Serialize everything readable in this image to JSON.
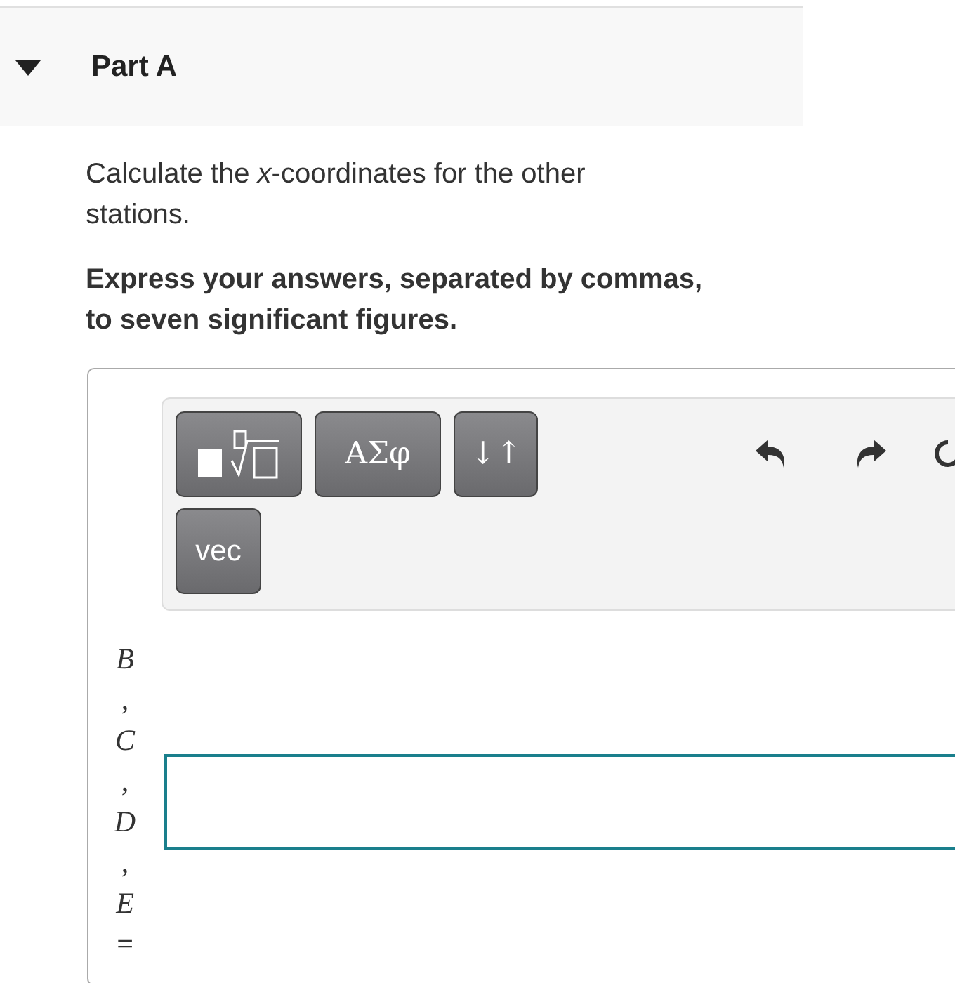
{
  "part": {
    "title": "Part A",
    "expanded": true
  },
  "question": "Calculate the *x*-coordinates for the other stations.",
  "instruction": "Express your answers, separated by commas, to seven significant figures.",
  "toolbar": {
    "buttons": [
      {
        "kind": "templates"
      },
      {
        "kind": "text",
        "label": "ΑΣφ"
      },
      {
        "kind": "text",
        "label": "↓↑"
      },
      {
        "kind": "text",
        "label": "vec"
      }
    ],
    "actions": [
      {
        "kind": "undo"
      },
      {
        "kind": "redo"
      },
      {
        "kind": "reset"
      }
    ]
  },
  "answer": {
    "label_parts": [
      "B",
      ",",
      "C",
      ",",
      "D",
      ",",
      "E",
      "="
    ]
  }
}
